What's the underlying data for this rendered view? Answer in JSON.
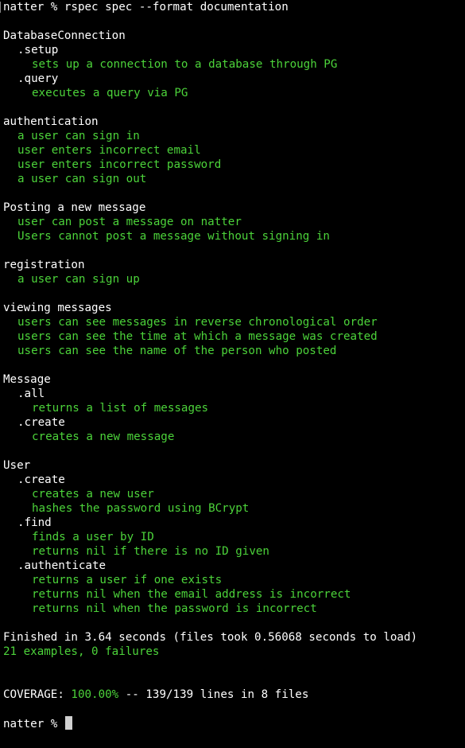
{
  "colors": {
    "background": "#000000",
    "text": "#ffffff",
    "pass": "#4cd33a",
    "cursor": "#d0d0d0"
  },
  "command": {
    "prompt": "natter %",
    "text": "rspec spec --format documentation"
  },
  "groups": {
    "db": {
      "title": "DatabaseConnection",
      "setup": ".setup",
      "setup_ex": "sets up a connection to a database through PG",
      "query": ".query",
      "query_ex": "executes a query via PG"
    },
    "auth": {
      "title": "authentication",
      "ex1": "a user can sign in",
      "ex2": "user enters incorrect email",
      "ex3": "user enters incorrect password",
      "ex4": "a user can sign out"
    },
    "post": {
      "title": "Posting a new message",
      "ex1": "user can post a message on natter",
      "ex2": "Users cannot post a message without signing in"
    },
    "reg": {
      "title": "registration",
      "ex1": "a user can sign up"
    },
    "view": {
      "title": "viewing messages",
      "ex1": "users can see messages in reverse chronological order",
      "ex2": "users can see the time at which a message was created",
      "ex3": "users can see the name of the person who posted"
    },
    "message": {
      "title": "Message",
      "all": ".all",
      "all_ex": "returns a list of messages",
      "create": ".create",
      "create_ex": "creates a new message"
    },
    "user": {
      "title": "User",
      "create": ".create",
      "create_ex1": "creates a new user",
      "create_ex2": "hashes the password using BCrypt",
      "find": ".find",
      "find_ex1": "finds a user by ID",
      "find_ex2": "returns nil if there is no ID given",
      "auth": ".authenticate",
      "auth_ex1": "returns a user if one exists",
      "auth_ex2": "returns nil when the email address is incorrect",
      "auth_ex3": "returns nil when the password is incorrect"
    }
  },
  "summary": {
    "finished": "Finished in 3.64 seconds (files took 0.56068 seconds to load)",
    "examples": "21 examples, 0 failures"
  },
  "coverage": {
    "label": "COVERAGE:",
    "percent": "100.00%",
    "rest": "-- 139/139 lines in 8 files"
  },
  "final_prompt": "natter %"
}
